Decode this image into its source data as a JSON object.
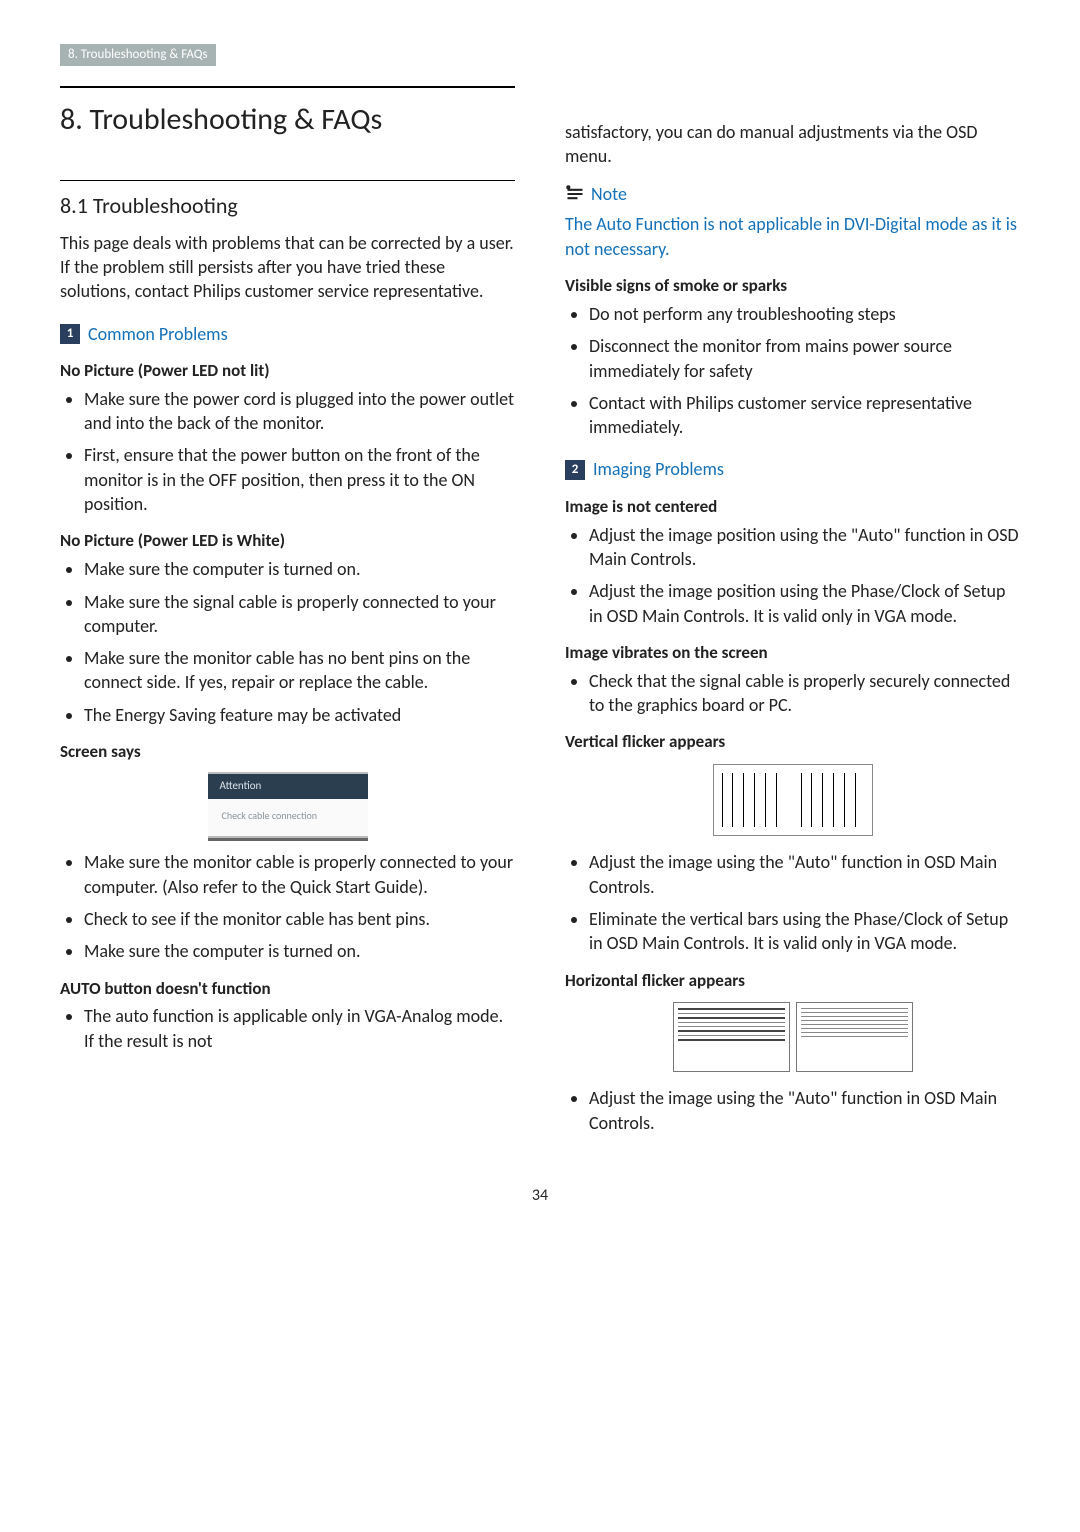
{
  "breadcrumb": "8. Troubleshooting & FAQs",
  "chapter_title": "8.  Troubleshooting & FAQs",
  "section_title": "8.1  Troubleshooting",
  "intro": "This page deals with problems that can be corrected by a user. If the problem still persists after you have tried these solutions, contact Philips customer service representative.",
  "s1": {
    "num": "1",
    "heading": "Common Problems",
    "t1": {
      "title": "No Picture (Power LED not lit)",
      "items": [
        "Make sure the power cord is plugged into the power outlet and into the back of the monitor.",
        "First, ensure that the power button on the front of the monitor is in the OFF position, then press it to the ON position."
      ]
    },
    "t2": {
      "title": "No Picture (Power LED is White)",
      "items": [
        "Make sure the computer is turned on.",
        "Make sure the signal cable is properly connected to your computer.",
        "Make sure the monitor cable has no bent pins on the connect side. If yes, repair or replace the cable.",
        "The Energy Saving feature may be activated"
      ]
    },
    "t3": {
      "title": "Screen says",
      "callout_header": "Attention",
      "callout_body": "Check cable connection",
      "items": [
        "Make sure the monitor cable is properly connected to your computer. (Also refer to the Quick Start Guide).",
        "Check to see if the monitor cable has bent pins.",
        "Make sure the computer is turned on."
      ]
    },
    "t4": {
      "title": "AUTO button doesn't function",
      "items": [
        "The auto function is applicable only in VGA-Analog mode.  If the result is not satisfactory, you can do manual adjustments via the OSD menu."
      ]
    }
  },
  "note": {
    "heading": "Note",
    "text": "The Auto Function is not applicable in DVI-Digital mode as it is not necessary."
  },
  "t5": {
    "title": "Visible signs of smoke or sparks",
    "items": [
      "Do not perform any troubleshooting steps",
      "Disconnect the monitor from mains power source immediately for safety",
      "Contact with Philips customer service representative immediately."
    ]
  },
  "s2": {
    "num": "2",
    "heading": "Imaging Problems",
    "t1": {
      "title": "Image is not centered",
      "items": [
        "Adjust the image position using the \"Auto\" function in OSD Main Controls.",
        "Adjust the image position using the Phase/Clock of Setup in OSD Main Controls.  It is valid only in VGA mode."
      ]
    },
    "t2": {
      "title": "Image vibrates on the screen",
      "items": [
        "Check that the signal cable is properly securely connected to the graphics board or PC."
      ]
    },
    "t3": {
      "title": "Vertical flicker appears",
      "items": [
        "Adjust the image using the \"Auto\" function in OSD Main Controls.",
        "Eliminate the vertical bars using the Phase/Clock of Setup in OSD Main Controls. It is valid only in VGA mode."
      ]
    },
    "t4": {
      "title": "Horizontal flicker appears",
      "items": [
        "Adjust the image using the \"Auto\" function in OSD Main Controls."
      ]
    }
  },
  "page_number": "34"
}
